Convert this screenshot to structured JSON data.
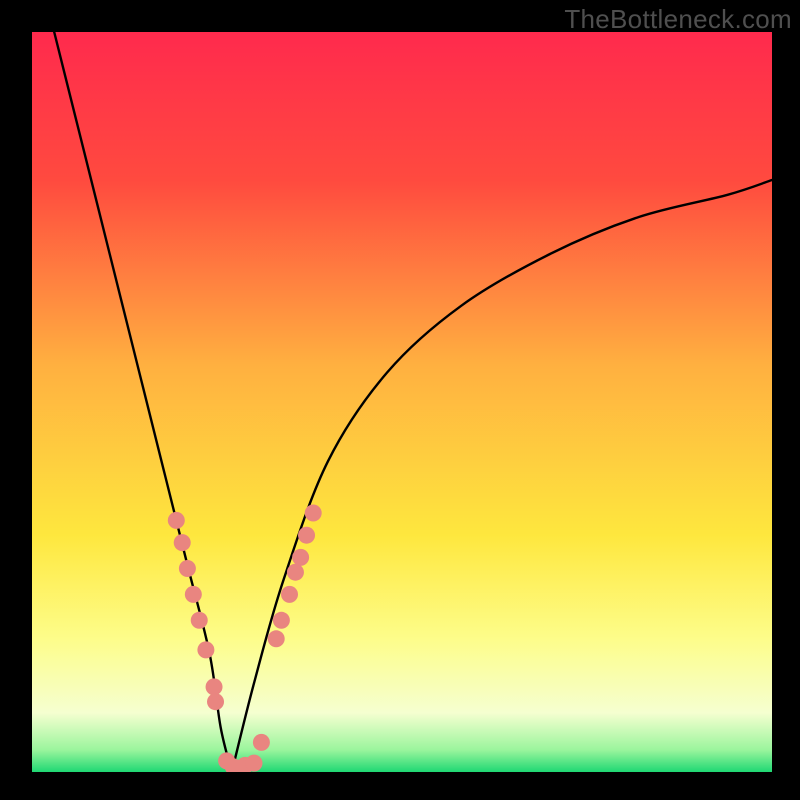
{
  "watermark": "TheBottleneck.com",
  "chart_data": {
    "type": "line",
    "title": "",
    "xlabel": "",
    "ylabel": "",
    "xlim": [
      0,
      100
    ],
    "ylim": [
      0,
      100
    ],
    "background_gradient": {
      "stops": [
        {
          "pos": 0.0,
          "color": "#ff2a4d"
        },
        {
          "pos": 0.2,
          "color": "#ff4a3f"
        },
        {
          "pos": 0.45,
          "color": "#ffb040"
        },
        {
          "pos": 0.68,
          "color": "#fee73e"
        },
        {
          "pos": 0.82,
          "color": "#fdfd8a"
        },
        {
          "pos": 0.92,
          "color": "#f5ffd0"
        },
        {
          "pos": 0.97,
          "color": "#9bf59d"
        },
        {
          "pos": 1.0,
          "color": "#1fd873"
        }
      ]
    },
    "series": [
      {
        "name": "left-branch",
        "x": [
          3,
          6,
          9,
          12,
          15,
          18,
          21,
          24,
          25.5,
          27
        ],
        "y": [
          100,
          88,
          76,
          64,
          52,
          40,
          28,
          16,
          6,
          0
        ]
      },
      {
        "name": "right-branch",
        "x": [
          27,
          30,
          34,
          40,
          48,
          58,
          70,
          82,
          94,
          100
        ],
        "y": [
          0,
          12,
          26,
          42,
          54,
          63,
          70,
          75,
          78,
          80
        ]
      }
    ],
    "scatter": {
      "name": "highlight-points",
      "color": "#e98580",
      "points": [
        {
          "x": 19.5,
          "y": 34
        },
        {
          "x": 20.3,
          "y": 31
        },
        {
          "x": 21.0,
          "y": 27.5
        },
        {
          "x": 21.8,
          "y": 24
        },
        {
          "x": 22.6,
          "y": 20.5
        },
        {
          "x": 23.5,
          "y": 16.5
        },
        {
          "x": 24.6,
          "y": 11.5
        },
        {
          "x": 24.8,
          "y": 9.5
        },
        {
          "x": 26.3,
          "y": 1.5
        },
        {
          "x": 27.2,
          "y": 0.7
        },
        {
          "x": 28.8,
          "y": 0.9
        },
        {
          "x": 30.0,
          "y": 1.2
        },
        {
          "x": 31.0,
          "y": 4
        },
        {
          "x": 33.0,
          "y": 18
        },
        {
          "x": 33.7,
          "y": 20.5
        },
        {
          "x": 34.8,
          "y": 24
        },
        {
          "x": 35.6,
          "y": 27
        },
        {
          "x": 36.3,
          "y": 29
        },
        {
          "x": 37.1,
          "y": 32
        },
        {
          "x": 38.0,
          "y": 35
        }
      ]
    }
  }
}
